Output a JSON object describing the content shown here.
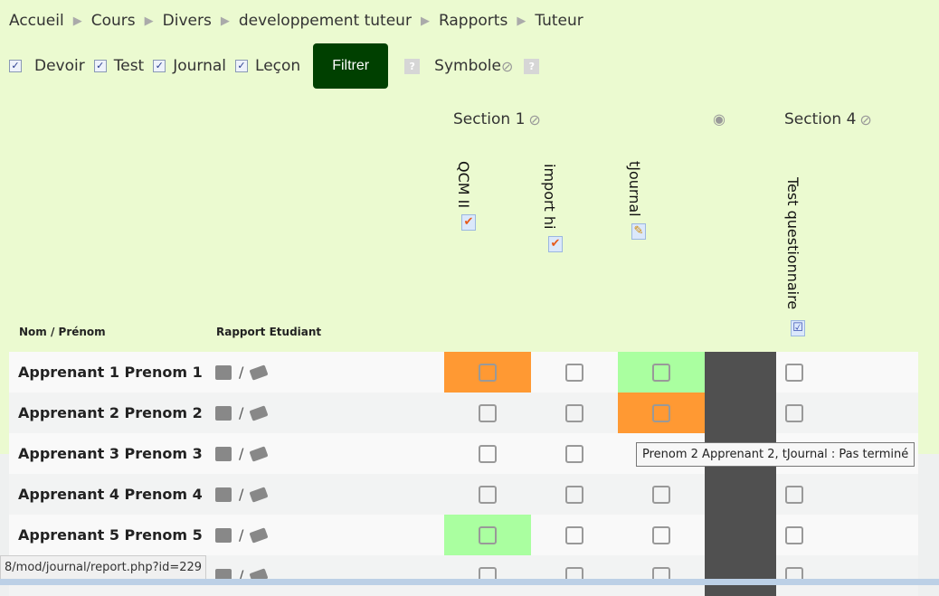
{
  "breadcrumb": [
    "Accueil",
    "Cours",
    "Divers",
    "developpement tuteur",
    "Rapports",
    "Tuteur"
  ],
  "filters": {
    "items": [
      {
        "label": "Devoir",
        "checked": true
      },
      {
        "label": "Test",
        "checked": true
      },
      {
        "label": "Journal",
        "checked": true
      },
      {
        "label": "Leçon",
        "checked": true
      }
    ],
    "button": "Filtrer",
    "help": "?",
    "symbol_label": "Symbole"
  },
  "sections": {
    "s1": "Section 1",
    "s4": "Section 4"
  },
  "columns": {
    "name": "Nom / Prénom",
    "report": "Rapport Etudiant",
    "activities": [
      "QCM II",
      "import hi",
      "tJournal",
      "Test questionnaire"
    ]
  },
  "rows": [
    {
      "name": "Apprenant 1 Prenom 1",
      "sep": "/",
      "colors": [
        "#ff9933",
        "",
        "#aaffa0",
        ""
      ]
    },
    {
      "name": "Apprenant 2 Prenom 2",
      "sep": "/",
      "colors": [
        "",
        "",
        "#ff9933",
        ""
      ]
    },
    {
      "name": "Apprenant 3 Prenom 3",
      "sep": "/",
      "colors": [
        "",
        "",
        "",
        ""
      ]
    },
    {
      "name": "Apprenant 4 Prenom 4",
      "sep": "/",
      "colors": [
        "",
        "",
        "",
        ""
      ]
    },
    {
      "name": "Apprenant 5 Prenom 5",
      "sep": "/",
      "colors": [
        "#aaffa0",
        "",
        "",
        ""
      ]
    },
    {
      "name": "",
      "sep": "/",
      "colors": [
        "",
        "",
        "",
        ""
      ]
    }
  ],
  "tooltip": "Prenom 2 Apprenant 2, tJournal : Pas terminé",
  "status_url": "8/mod/journal/report.php?id=229"
}
